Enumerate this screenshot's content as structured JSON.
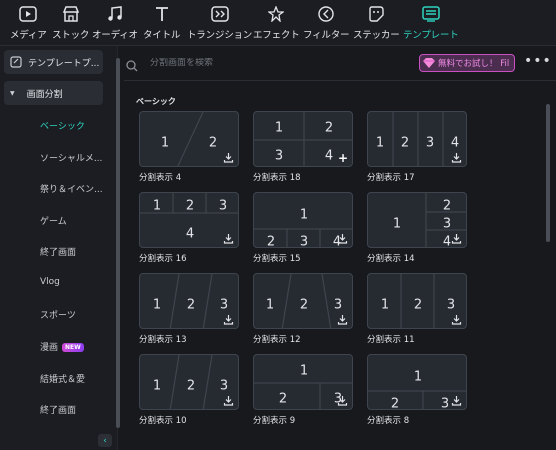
{
  "toolbar": {
    "items": [
      {
        "label": "メディア",
        "icon": "media-icon"
      },
      {
        "label": "ストック",
        "icon": "stock-icon"
      },
      {
        "label": "オーディオ",
        "icon": "audio-icon"
      },
      {
        "label": "タイトル",
        "icon": "title-icon"
      },
      {
        "label": "トランジション",
        "icon": "transition-icon"
      },
      {
        "label": "エフェクト",
        "icon": "effect-icon"
      },
      {
        "label": "フィルター",
        "icon": "filter-icon"
      },
      {
        "label": "ステッカー",
        "icon": "sticker-icon"
      },
      {
        "label": "テンプレート",
        "icon": "template-icon",
        "active": true
      }
    ],
    "accent": "#2fd3c0"
  },
  "sidebar": {
    "top_category": "テンプレートプ...",
    "group": "画面分割",
    "items": [
      "ベーシック",
      "ソーシャルメ...",
      "祭り＆イベン...",
      "ゲーム",
      "終了画面",
      "Vlog",
      "スポーツ",
      "漫画",
      "結婚式＆愛",
      "終了画面"
    ],
    "new_badge": "NEW"
  },
  "search": {
    "placeholder": "分割画面を検索",
    "value": ""
  },
  "promo": {
    "label": "無料でお試し！ Fil"
  },
  "section": {
    "title": "ベーシック"
  },
  "cards": [
    {
      "label": "分割表示 4",
      "nums": [
        "1",
        "2"
      ]
    },
    {
      "label": "分割表示 18",
      "nums": [
        "1",
        "2",
        "3",
        "4"
      ]
    },
    {
      "label": "分割表示 17",
      "nums": [
        "1",
        "2",
        "3",
        "4"
      ]
    },
    {
      "label": "分割表示 16",
      "nums": [
        "1",
        "2",
        "3",
        "4"
      ]
    },
    {
      "label": "分割表示 15",
      "nums": [
        "1",
        "2",
        "3",
        "4"
      ]
    },
    {
      "label": "分割表示 14",
      "nums": [
        "1",
        "2",
        "3",
        "4"
      ]
    },
    {
      "label": "分割表示 13",
      "nums": [
        "1",
        "2",
        "3"
      ]
    },
    {
      "label": "分割表示 12",
      "nums": [
        "1",
        "2",
        "3"
      ]
    },
    {
      "label": "分割表示 11",
      "nums": [
        "1",
        "2",
        "3"
      ]
    },
    {
      "label": "分割表示 10",
      "nums": [
        "1",
        "2",
        "3"
      ]
    },
    {
      "label": "分割表示 9",
      "nums": [
        "1",
        "2",
        "3"
      ]
    },
    {
      "label": "分割表示 8",
      "nums": [
        "1",
        "2",
        "3"
      ]
    }
  ]
}
